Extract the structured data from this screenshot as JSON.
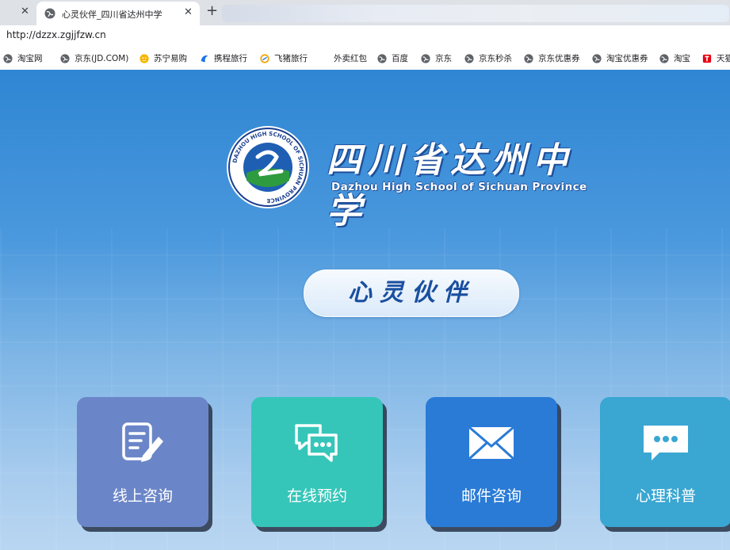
{
  "browser": {
    "tab_title": "心灵伙伴_四川省达州中学",
    "url": "http://dzzx.zgjjfzw.cn"
  },
  "bookmarks": [
    {
      "label": "淘宝网",
      "icon": "globe-icon"
    },
    {
      "label": "京东(JD.COM)",
      "icon": "globe-icon"
    },
    {
      "label": "苏宁易购",
      "icon": "suning-icon"
    },
    {
      "label": "携程旅行",
      "icon": "ctrip-icon"
    },
    {
      "label": "飞猪旅行",
      "icon": "fliggy-icon"
    },
    {
      "label": "外卖红包",
      "icon": ""
    },
    {
      "label": "百度",
      "icon": "globe-icon"
    },
    {
      "label": "京东",
      "icon": "globe-icon"
    },
    {
      "label": "京东秒杀",
      "icon": "globe-icon"
    },
    {
      "label": "京东优惠券",
      "icon": "globe-icon"
    },
    {
      "label": "淘宝优惠券",
      "icon": "globe-icon"
    },
    {
      "label": "淘宝",
      "icon": "globe-icon"
    },
    {
      "label": "天猫",
      "icon": "tmall-icon"
    }
  ],
  "header": {
    "school_name_cn": "四川省达州中学",
    "school_name_en": "Dazhou High School of Sichuan Province",
    "logo_text": "DAZHOU HIGH SCHOOL OF SICHUAN PROVINCE"
  },
  "slogan": "心灵伙伴",
  "cards": [
    {
      "label": "线上咨询",
      "icon": "edit-form-icon",
      "color": "#6b86c8"
    },
    {
      "label": "在线预约",
      "icon": "chat-bubbles-icon",
      "color": "#35c6b9"
    },
    {
      "label": "邮件咨询",
      "icon": "envelope-icon",
      "color": "#2a7bd6"
    },
    {
      "label": "心理科普",
      "icon": "speech-bubble-icon",
      "color": "#3aa6d2"
    }
  ]
}
